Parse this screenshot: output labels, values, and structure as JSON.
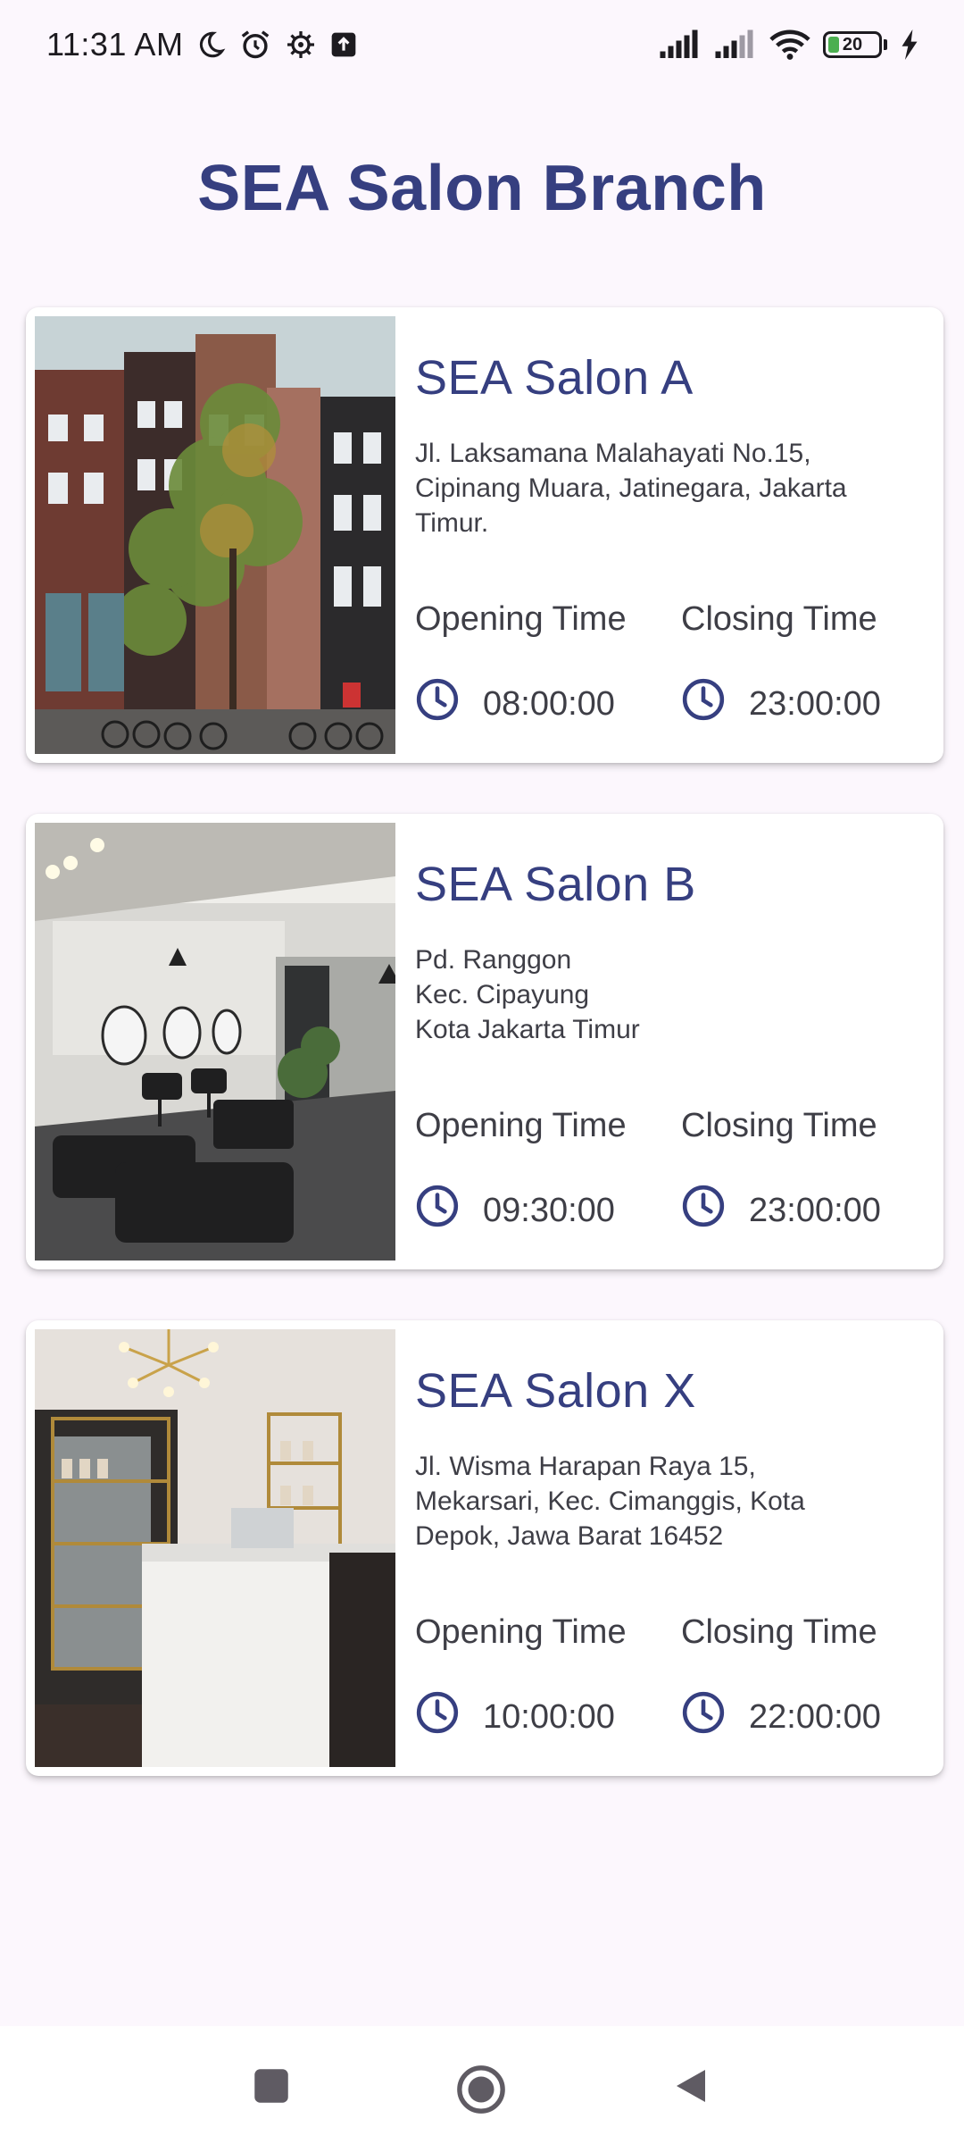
{
  "status_bar": {
    "time": "11:31 AM",
    "battery_level": "20",
    "icons": [
      "moon-icon",
      "alarm-icon",
      "settings-icon",
      "upload-icon",
      "signal-icon",
      "signal-icon",
      "wifi-icon",
      "battery-icon",
      "charging-icon"
    ]
  },
  "page": {
    "title": "SEA Salon Branch"
  },
  "branches": [
    {
      "name": "SEA Salon A",
      "address": "Jl. Laksamana Malahayati No.15,\nCipinang Muara, Jatinegara, Jakarta\nTimur.",
      "opening_label": "Opening Time",
      "closing_label": "Closing Time",
      "opening_time": "08:00:00",
      "closing_time": "23:00:00"
    },
    {
      "name": "SEA Salon B",
      "address": "Pd. Ranggon\nKec. Cipayung\nKota Jakarta Timur",
      "opening_label": "Opening Time",
      "closing_label": "Closing Time",
      "opening_time": "09:30:00",
      "closing_time": "23:00:00"
    },
    {
      "name": "SEA Salon X",
      "address": "Jl. Wisma Harapan Raya 15,\nMekarsari, Kec. Cimanggis, Kota\nDepok, Jawa Barat 16452",
      "opening_label": "Opening Time",
      "closing_label": "Closing Time",
      "opening_time": "10:00:00",
      "closing_time": "22:00:00"
    }
  ],
  "colors": {
    "accent": "#363f80",
    "background": "#fcf7fd",
    "card": "#ffffff",
    "text": "#3e3e46"
  },
  "navigation": {
    "buttons": [
      "recent-apps-button",
      "home-button",
      "back-button"
    ]
  }
}
